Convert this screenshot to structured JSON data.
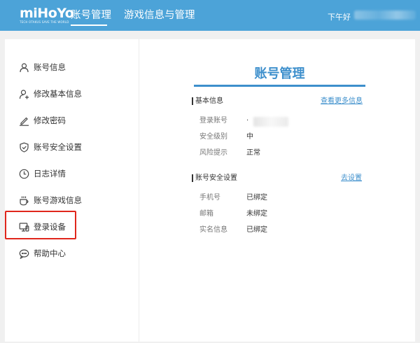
{
  "header": {
    "logo_text": "miHoYo",
    "logo_tagline": "TECH OTAKUS SAVE THE WORLD",
    "tabs": [
      {
        "label": "账号管理",
        "active": true
      },
      {
        "label": "游戏信息与管理",
        "active": false
      }
    ],
    "greeting": "下午好",
    "accent_color": "#4ca3d8"
  },
  "sidebar": {
    "items": [
      {
        "label": "账号信息",
        "icon": "user-icon"
      },
      {
        "label": "修改基本信息",
        "icon": "user-edit-icon"
      },
      {
        "label": "修改密码",
        "icon": "pencil-icon"
      },
      {
        "label": "账号安全设置",
        "icon": "shield-icon"
      },
      {
        "label": "日志详情",
        "icon": "clock-icon"
      },
      {
        "label": "账号游戏信息",
        "icon": "cup-icon"
      },
      {
        "label": "登录设备",
        "icon": "monitor-icon",
        "highlighted": true
      },
      {
        "label": "帮助中心",
        "icon": "chat-icon"
      }
    ],
    "highlight_color": "#e0261c"
  },
  "main": {
    "title": "账号管理",
    "basic_info": {
      "title": "基本信息",
      "link": "查看更多信息",
      "rows": [
        {
          "key": "登录账号",
          "value": "·"
        },
        {
          "key": "安全级别",
          "value": "中"
        },
        {
          "key": "风险提示",
          "value": "正常"
        }
      ]
    },
    "security": {
      "title": "账号安全设置",
      "link": "去设置",
      "rows": [
        {
          "key": "手机号",
          "value": "已绑定"
        },
        {
          "key": "邮箱",
          "value": "未绑定"
        },
        {
          "key": "实名信息",
          "value": "已绑定"
        }
      ]
    }
  }
}
